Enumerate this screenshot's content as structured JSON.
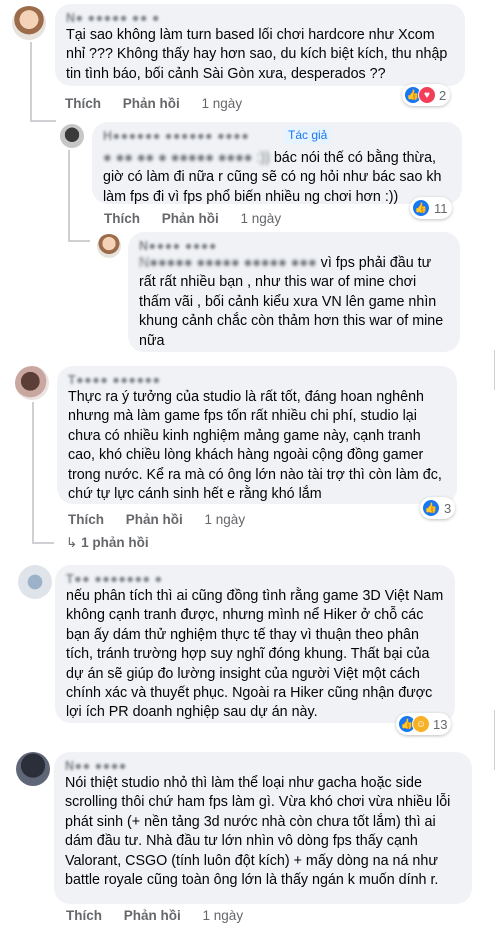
{
  "comments": [
    {
      "author": "N● ●●●●● ●● ●",
      "text": "Tại sao không làm turn based lối chơi hardcore như Xcom nhỉ ??? Không thấy hay hơn sao, du kích biệt kích, thu nhập tin tình báo, bối cảnh Sài Gòn xưa, desperados ??",
      "like_label": "Thích",
      "reply_label": "Phản hồi",
      "time": "1 ngày",
      "reaction_count": "2"
    },
    {
      "author": "H●●●●●● ●●●●●● ●●●●",
      "author_tag": "Tác giả",
      "text": "bác nói thế có bằng thừa, giờ có làm đi nữa r cũng sẽ có ng hỏi như bác sao kh làm fps đi vì fps phổ biến nhiều ng chơi hơn :))",
      "text_prefix": "● ●● ●● ● ●●●●● ●●●● :))",
      "like_label": "Thích",
      "reply_label": "Phản hồi",
      "time": "1 ngày",
      "reaction_count": "11"
    },
    {
      "author": "N●●●● ●●●●",
      "text": "vì fps phải đầu tư rất rất nhiều bạn , như this war of mine chơi thấm vãi , bối cảnh kiểu xưa VN lên game nhìn khung cảnh chắc còn thảm hơn this war of mine nữa",
      "text_prefix": "N●●●●● ●●●●● ●●●●● ●●●"
    },
    {
      "author": "T●●●● ●●●●●●",
      "text": "Thực ra ý tưởng của studio là rất tốt, đáng hoan nghênh nhưng mà làm game fps tốn rất nhiều chi phí, studio lại chưa có nhiều kinh nghiệm mảng game này, cạnh tranh cao, khó chiều lòng khách hàng ngoài cộng đồng gamer trong nước. Kể ra mà có ông lớn nào tài trợ thì còn làm đc, chứ tự lực cánh sinh hết e rằng khó lắm",
      "like_label": "Thích",
      "reply_label": "Phản hồi",
      "time": "1 ngày",
      "reaction_count": "3",
      "replies_label": "1 phản hồi"
    },
    {
      "author": "T●● ●●●●●●● ●",
      "text": "nếu phân tích thì ai cũng đồng tình rằng game 3D Việt Nam không cạnh tranh được, nhưng mình nể Hiker ở chỗ các bạn ấy dám thử nghiệm thực tế thay vì thuận theo phân tích, tránh trường hợp suy nghĩ đóng khung. Thất bại của dự án sẽ giúp đo lường insight của người Việt một cách chính xác và thuyết phục. Ngoài ra Hiker cũng nhận được lợi ích PR doanh nghiệp sau dự án này.",
      "reaction_count": "13"
    },
    {
      "author": "N●● ●●●●",
      "text": "Nói thiệt studio nhỏ thì làm thể loại như gacha hoặc side scrolling thôi chứ ham fps làm gì. Vừa khó chơi vừa nhiều lỗi phát sinh (+ nền tảng 3d nước nhà còn chưa tốt lắm) thì ai dám đầu tư. Nhà đầu tư lớn nhìn vô dòng fps thấy cạnh Valorant, CSGO (tính luôn đột kích) + mấy dòng na ná như battle royale cũng toàn ông lớn là thấy ngán k muốn dính r.",
      "like_label": "Thích",
      "reply_label": "Phản hồi",
      "time": "1 ngày"
    }
  ],
  "colors": {
    "bubble": "#f0f2f5",
    "action_text": "#65676b",
    "like_blue": "#1877f2",
    "love_red": "#f33e58",
    "haha_yellow": "#f7b125"
  }
}
